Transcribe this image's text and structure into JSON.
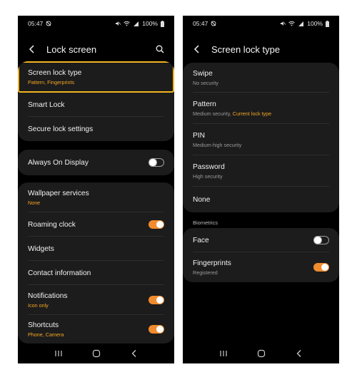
{
  "status_bar": {
    "time": "05:47",
    "battery": "100%"
  },
  "left": {
    "title": "Lock screen",
    "group1": [
      {
        "label": "Screen lock type",
        "sub": "Pattern, Fingerprints"
      },
      {
        "label": "Smart Lock"
      },
      {
        "label": "Secure lock settings"
      }
    ],
    "aod": {
      "label": "Always On Display",
      "toggle": "off"
    },
    "group3": [
      {
        "label": "Wallpaper services",
        "sub": "None"
      },
      {
        "label": "Roaming clock",
        "toggle": "on"
      },
      {
        "label": "Widgets"
      },
      {
        "label": "Contact information"
      },
      {
        "label": "Notifications",
        "sub": "Icon only",
        "toggle": "on"
      },
      {
        "label": "Shortcuts",
        "sub": "Phone, Camera",
        "toggle": "on"
      }
    ]
  },
  "right": {
    "title": "Screen lock type",
    "options": [
      {
        "label": "Swipe",
        "sub": "No security"
      },
      {
        "label": "Pattern",
        "sub": "Medium security, ",
        "sub_current": "Current lock type"
      },
      {
        "label": "PIN",
        "sub": "Medium-high security"
      },
      {
        "label": "Password",
        "sub": "High security"
      },
      {
        "label": "None"
      }
    ],
    "biometrics_header": "Biometrics",
    "biometrics": [
      {
        "label": "Face",
        "toggle": "off"
      },
      {
        "label": "Fingerprints",
        "sub": "Registered",
        "toggle": "on"
      }
    ]
  },
  "colors": {
    "accent": "#f5a623",
    "highlight": "#f2b51f",
    "toggle_on": "#f08c2e",
    "card": "#1c1c1c"
  },
  "icons": [
    "mute-icon",
    "wifi-icon",
    "signal-icon",
    "battery-icon",
    "back-arrow-icon",
    "search-icon",
    "recents-icon",
    "home-icon",
    "nav-back-icon"
  ]
}
